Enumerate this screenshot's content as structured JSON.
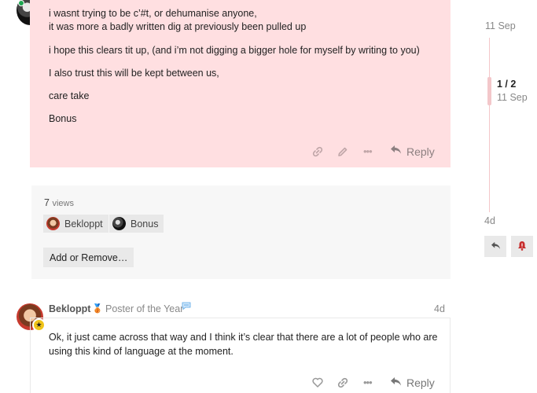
{
  "post1": {
    "lines": [
      "i wasnt trying to be c’#t, or dehumanise anyone,",
      "it was more a badly written dig at previously been pulled up",
      "i hope this clears tit up, (and i’m not digging a bigger hole for myself by writing to you)",
      "I also trust this will be kept between us,",
      "care take",
      "Bonus"
    ],
    "actions": {
      "reply_label": "Reply"
    },
    "avatar_icon": "avatar-bw-icon"
  },
  "views": {
    "count": "7",
    "label": "views",
    "users": [
      {
        "name": "Bekloppt"
      },
      {
        "name": "Bonus"
      }
    ],
    "add_remove_label": "Add or Remove…"
  },
  "post2": {
    "username": "Bekloppt",
    "flair": "Poster of the Year",
    "date": "4d",
    "body": "Ok, it just came across that way and I think it’s clear that there are a lot of people who are using this kind of language at the moment.",
    "reply_label": "Reply"
  },
  "timeline": {
    "top_date": "11 Sep",
    "position": "1 / 2",
    "position_date": "11 Sep",
    "bottom_date": "4d"
  },
  "colors": {
    "highlight_bg": "#ffdfe1",
    "timeline_accent": "#f3c7ca",
    "flag_red": "#c62c2c"
  }
}
